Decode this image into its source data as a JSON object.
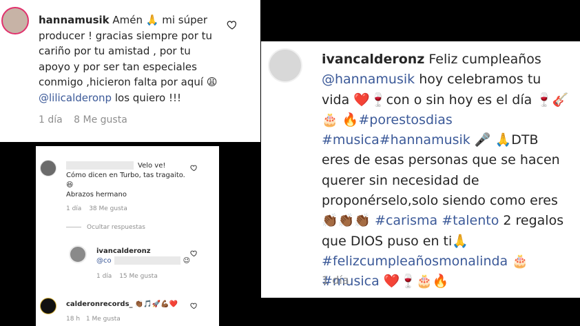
{
  "comment1": {
    "username": "hannamusik",
    "text_before_mention": "Amén 🙏 mi súper producer ! gracias siempre por tu cariño por tu amistad , por tu apoyo y por ser tan especiales conmigo ,hicieron falta por aquí 😩",
    "mention": "@lilicalderonp",
    "text_after_mention": "los quiero !!!",
    "time": "1 día",
    "likes": "8 Me gusta"
  },
  "comment2": {
    "text_after_redaction": "Velo ve!",
    "text_body": "Cómo dicen en Turbo, tas tragaito. 😆",
    "text_closing": "Abrazos hermano",
    "time": "1 día",
    "likes": "38 Me gusta",
    "hide_replies": "Ocultar respuestas"
  },
  "reply": {
    "username": "ivancalderonz",
    "mention_prefix": "@co",
    "emoji": "😉",
    "time": "1 día",
    "likes": "15 Me gusta"
  },
  "comment3": {
    "username": "calderonrecords_",
    "emojis": "👏🏾🎵🚀💪🏾❤️",
    "time": "18 h",
    "likes": "1 Me gusta"
  },
  "comment4": {
    "username": "ivancalderonz",
    "line1_text": "Feliz cumpleaños",
    "mention": "@hannamusik",
    "line2_text": "hoy celebramos tu vida",
    "line3": "❤️🍷con o sin hoy es el día 🍷🎸🎂",
    "line4_emoji": "🔥",
    "tag1": "#porestosdias",
    "tag2": "#musica#hannamusik",
    "line5_emoji": "🎤 🙏",
    "line5_text": "DTB eres de esas personas que se hacen querer sin necesidad de proponérselo,solo siendo como eres",
    "claps": "👏🏾👏🏾👏🏾",
    "tag3": "#carisma",
    "tag4": "#talento",
    "line7_text": "2 regalos que DIOS puso en ti🙏",
    "tag5": "#felizcumpleañosmonalinda",
    "cake": "🎂",
    "tag6": "#musica",
    "final_emojis": "❤️🍷🎂🔥",
    "time": "1 día"
  },
  "icons": {
    "heart_outline": "heart-outline-icon"
  },
  "colors": {
    "link": "#3b5998",
    "meta": "#8e8e8e",
    "story_ring": "#e1306c"
  }
}
